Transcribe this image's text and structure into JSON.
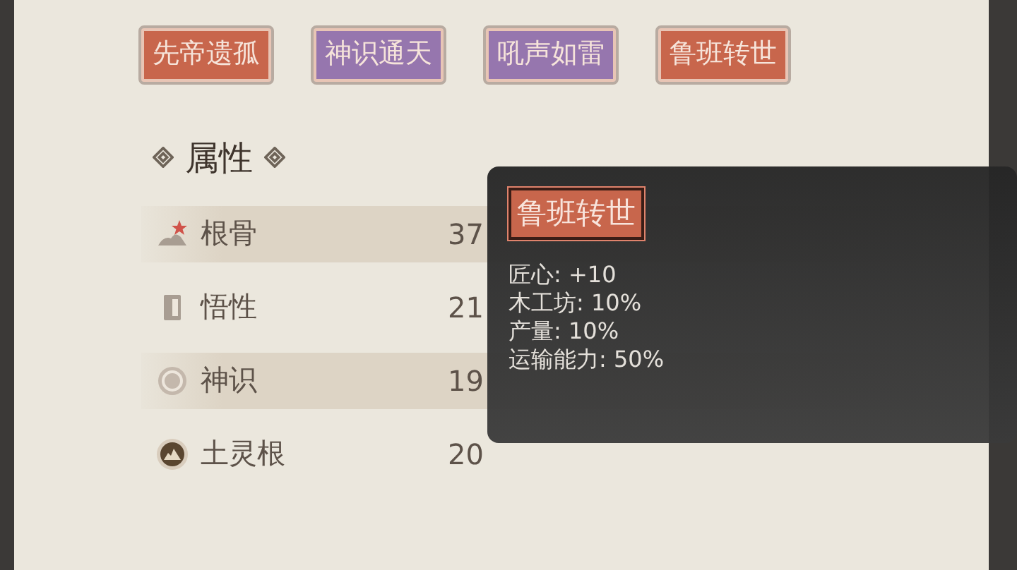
{
  "traits": [
    {
      "label": "先帝遗孤",
      "color": "#c8664c"
    },
    {
      "label": "神识通天",
      "color": "#9676ae"
    },
    {
      "label": "吼声如雷",
      "color": "#9676ae"
    },
    {
      "label": "鲁班转世",
      "color": "#c8664c"
    }
  ],
  "section": {
    "title": "属性"
  },
  "attributes": [
    {
      "label": "根骨",
      "value": "37"
    },
    {
      "label": "悟性",
      "value": "21"
    },
    {
      "label": "神识",
      "value": "19"
    },
    {
      "label": "土灵根",
      "value": "20"
    }
  ],
  "tooltip": {
    "title": "鲁班转世",
    "lines": [
      "匠心: +10",
      "木工坊: 10%",
      "产量: 10%",
      "运输能力: 50%"
    ]
  }
}
